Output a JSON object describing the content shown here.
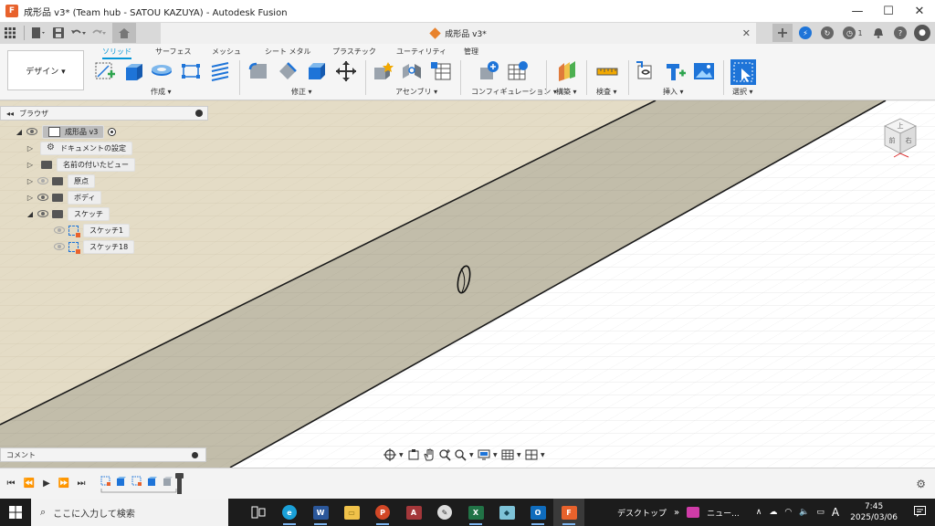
{
  "window": {
    "title": "成形品 v3* (Team hub - SATOU KAZUYA) - Autodesk Fusion",
    "minimize": "—",
    "maximize": "☐",
    "close": "✕"
  },
  "doc_tab": {
    "title": "成形品 v3*",
    "close": "✕"
  },
  "quick_right": {
    "job_count": "1"
  },
  "ribbon": {
    "workspace": "デザイン ▾",
    "tabs": [
      "ソリッド",
      "サーフェス",
      "メッシュ",
      "シート メタル",
      "プラスチック",
      "ユーティリティ",
      "管理"
    ],
    "groups": [
      "作成 ▾",
      "修正 ▾",
      "アセンブリ ▾",
      "コンフィギュレーション ▾",
      "構築 ▾",
      "検査 ▾",
      "挿入 ▾",
      "選択 ▾"
    ]
  },
  "browser": {
    "title": "ブラウザ",
    "root": "成形品 v3",
    "items": [
      "ドキュメントの設定",
      "名前の付いたビュー",
      "原点",
      "ボディ",
      "スケッチ"
    ],
    "sketches": [
      "スケッチ1",
      "スケッチ18"
    ]
  },
  "viewcube": {
    "top": "上",
    "front": "前",
    "right": "右"
  },
  "comments": {
    "title": "コメント"
  },
  "taskbar": {
    "search_placeholder": "ここに入力して検索",
    "desktop_label": "デスクトップ",
    "news_label": "ニュー...",
    "ime": "A",
    "time": "7:45",
    "date": "2025/03/06"
  },
  "colors": {
    "accent": "#0696d7",
    "plane_tan": "#e4dcc6",
    "plane_dark": "#c2bdaa",
    "fusion_orange": "#e8622c"
  }
}
